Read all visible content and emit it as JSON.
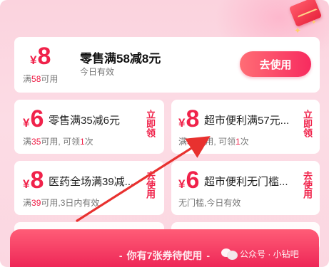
{
  "coupons": [
    {
      "currency": "¥",
      "amount": "8",
      "title": "零售满58减8元",
      "condition_prefix": "满",
      "condition_highlight": "58",
      "condition_suffix": "可用",
      "validity": "今日有效",
      "action": "去使用"
    },
    {
      "currency": "¥",
      "amount": "6",
      "title": "零售满35减6元",
      "condition_prefix": "满",
      "condition_highlight": "35",
      "condition_suffix": "可用, 可领",
      "count_highlight": "1",
      "count_suffix": "次",
      "action": "立即领"
    },
    {
      "currency": "¥",
      "amount": "8",
      "title": "超市便利满57元...",
      "condition_prefix": "满",
      "condition_highlight": "57",
      "condition_suffix": "可用, 可领",
      "count_highlight": "1",
      "count_suffix": "次",
      "action": "立即领"
    },
    {
      "currency": "¥",
      "amount": "8",
      "title": "医药全场满39减...",
      "condition_prefix": "满",
      "condition_highlight": "39",
      "condition_suffix": "可用,3日内有效",
      "action": "去使用"
    },
    {
      "currency": "¥",
      "amount": "6",
      "title": "超市便利无门槛...",
      "condition_prefix": "",
      "condition_highlight": "",
      "condition_suffix": "无门槛,今日有效",
      "action": "去使用"
    }
  ],
  "footer": {
    "dash_left": "-",
    "text": "你有7张券待使用",
    "dash_right": "-"
  },
  "watermark": {
    "text": "公众号 · 小钻吧"
  },
  "colors": {
    "accent": "#f0224a",
    "background": "#fbd3de",
    "button_gradient_start": "#ff6d75",
    "button_gradient_end": "#f72b5f",
    "annotation_arrow": "#e8312f"
  },
  "icons": [
    "red-envelope-icon",
    "sparkle-icon",
    "wechat-icon",
    "annotation-arrow"
  ]
}
